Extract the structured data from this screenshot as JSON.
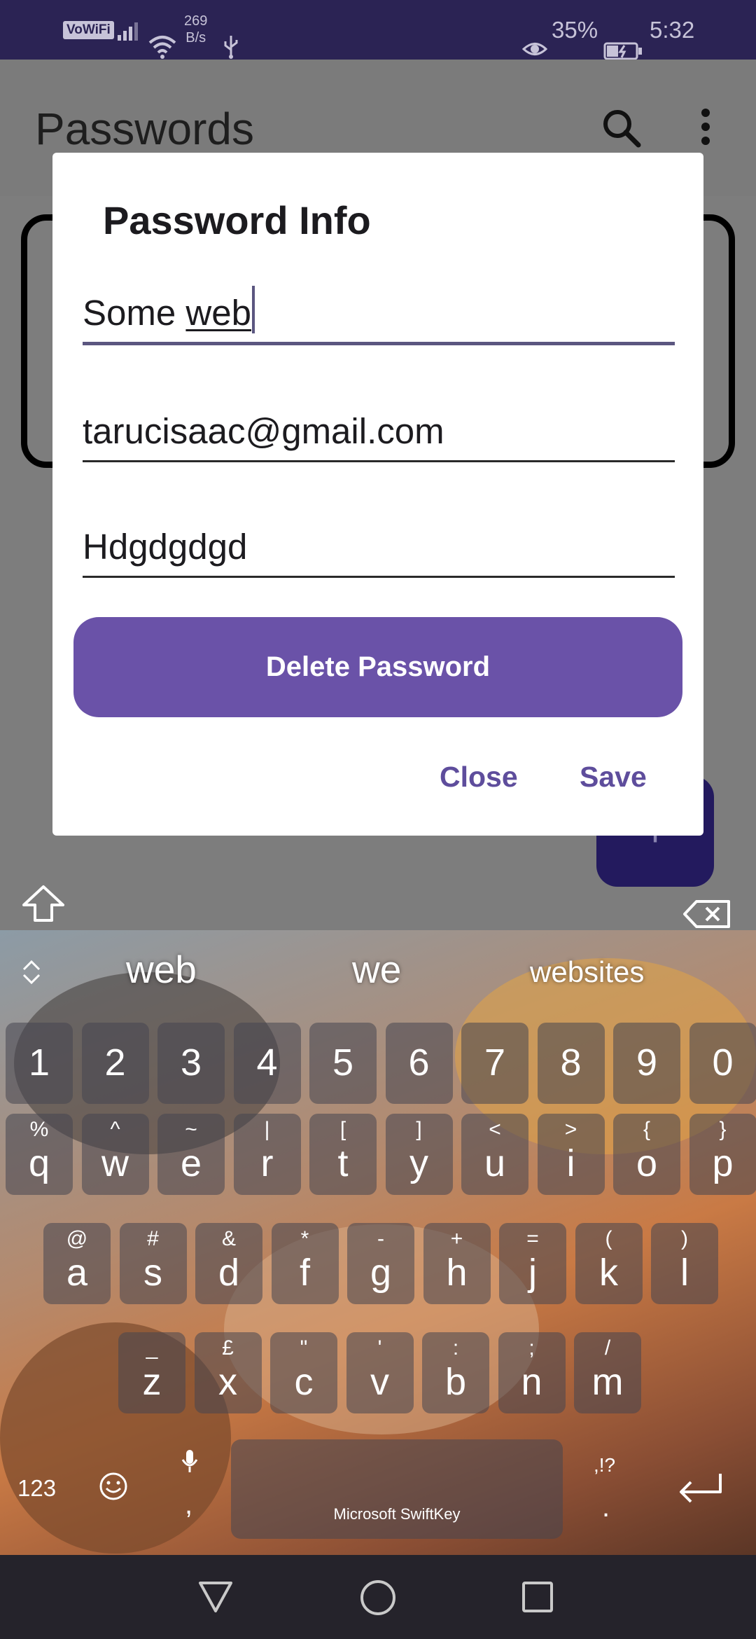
{
  "status_bar": {
    "volte": "VoWiFi",
    "speed_value": "269",
    "speed_unit": "B/s",
    "battery": "35%",
    "time": "5:32"
  },
  "app": {
    "title": "Passwords",
    "fab_label": "+"
  },
  "dialog": {
    "title": "Password Info",
    "site_prefix": "Some ",
    "site_current_word": "web",
    "email": "tarucisaac@gmail.com",
    "password": "Hdgdgdgd",
    "delete_label": "Delete Password",
    "close_label": "Close",
    "save_label": "Save"
  },
  "keyboard": {
    "suggestions": [
      "web",
      "we",
      "websites"
    ],
    "number_row": [
      "1",
      "2",
      "3",
      "4",
      "5",
      "6",
      "7",
      "8",
      "9",
      "0"
    ],
    "row1": [
      {
        "main": "q",
        "sub": "%"
      },
      {
        "main": "w",
        "sub": "^"
      },
      {
        "main": "e",
        "sub": "~"
      },
      {
        "main": "r",
        "sub": "|"
      },
      {
        "main": "t",
        "sub": "["
      },
      {
        "main": "y",
        "sub": "]"
      },
      {
        "main": "u",
        "sub": "<"
      },
      {
        "main": "i",
        "sub": ">"
      },
      {
        "main": "o",
        "sub": "{"
      },
      {
        "main": "p",
        "sub": "}"
      }
    ],
    "row2": [
      {
        "main": "a",
        "sub": "@"
      },
      {
        "main": "s",
        "sub": "#"
      },
      {
        "main": "d",
        "sub": "&"
      },
      {
        "main": "f",
        "sub": "*"
      },
      {
        "main": "g",
        "sub": "-"
      },
      {
        "main": "h",
        "sub": "+"
      },
      {
        "main": "j",
        "sub": "="
      },
      {
        "main": "k",
        "sub": "("
      },
      {
        "main": "l",
        "sub": ")"
      }
    ],
    "row3": [
      {
        "main": "z",
        "sub": "_"
      },
      {
        "main": "x",
        "sub": "£"
      },
      {
        "main": "c",
        "sub": "\""
      },
      {
        "main": "v",
        "sub": "'"
      },
      {
        "main": "b",
        "sub": ":"
      },
      {
        "main": "n",
        "sub": ";"
      },
      {
        "main": "m",
        "sub": "/"
      }
    ],
    "numbers_label": "123",
    "comma_label": ",",
    "space_label": "Microsoft SwiftKey",
    "punct_label": ",!?",
    "period_label": "."
  }
}
